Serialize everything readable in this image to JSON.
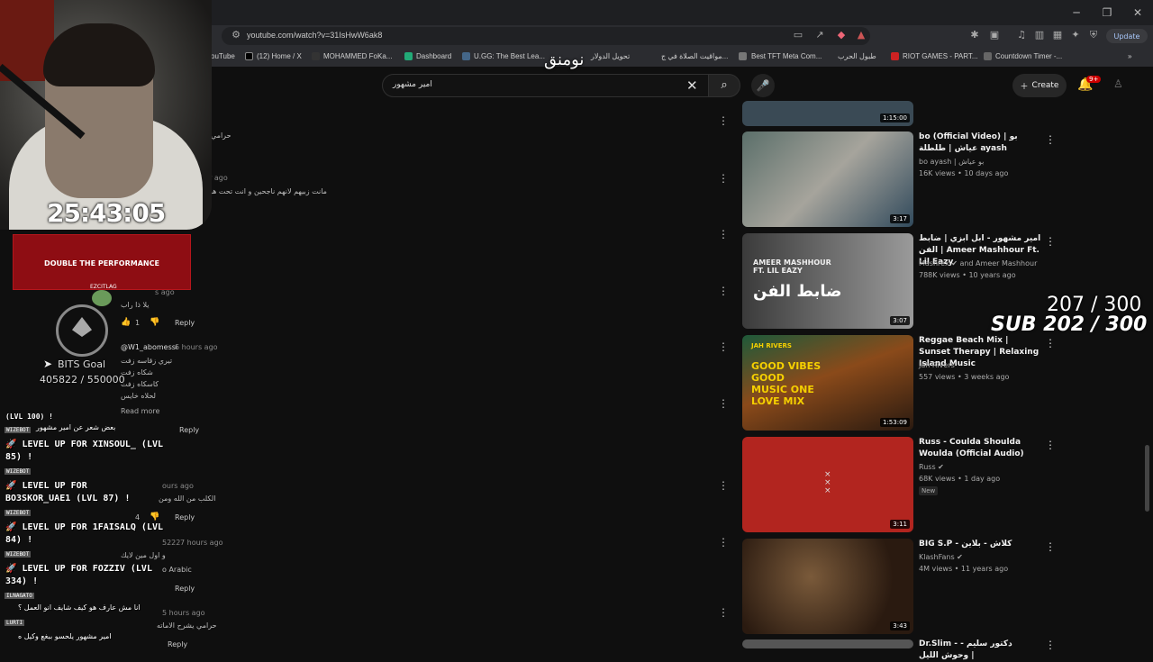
{
  "browser": {
    "url": "youtube.com/watch?v=31IsHwW6ak8",
    "update_label": "Update",
    "bookmarks": [
      {
        "label": "ouTube",
        "color": "#d00"
      },
      {
        "label": "(12) Home / X",
        "color": "#000"
      },
      {
        "label": "MOHAMMED FoKa...",
        "color": "#111"
      },
      {
        "label": "Dashboard",
        "color": "#2a7"
      },
      {
        "label": "U.GG: The Best Lea...",
        "color": "#468"
      },
      {
        "label": "تحويل الدولار",
        "color": "#333"
      },
      {
        "label": "مواقيت الصلاة في ج...",
        "color": "#555"
      },
      {
        "label": "Best TFT Meta Com...",
        "color": "#777"
      },
      {
        "label": "طبول الحرب",
        "color": "#444"
      },
      {
        "label": "RIOT GAMES - PART...",
        "color": "#c22"
      },
      {
        "label": "Countdown Timer -...",
        "color": "#666"
      }
    ]
  },
  "header": {
    "search_value": "امير مشهور",
    "create_label": "Create",
    "notif_count": "9+"
  },
  "overlay": {
    "timer": "25:43:05",
    "arabic_text": "نومنق",
    "promo": "DOUBLE THE PERFORMANCE",
    "promo_brand": "EZCITLAG",
    "bits_label": "BITS Goal",
    "bits_count": "405822 / 550000",
    "sub_line1": "207 / 300",
    "sub_line2": "SUB 202 / 300"
  },
  "comments": {
    "c1_text": "حرامي",
    "c2_time": "r ago",
    "c2_text": "مانت زبيهم لانهم ناجحين و انت تحت هو",
    "c3_time": "s ago",
    "c3_text": "يلا ذا راب",
    "c3_likes": "1",
    "reply": "Reply",
    "c4_user": "@W1_abomessi",
    "c4_time": "6 hours ago",
    "c4_lines": [
      "تيري زقاسه زفت",
      "شكاه زفت",
      "كاسكاه زفت",
      "لحلاه خايس"
    ],
    "read_more": "Read more",
    "c5_text": "بعض شعر عن امير مشهور",
    "c6_time": "ours ago",
    "c6_text": "الكلب من الله ومن",
    "c6_likes": "4",
    "c7_user": "5222",
    "c7_time": "7 hours ago",
    "c7_text": "و اول مين لايك",
    "c7_lang": "o Arabic",
    "c8_time": "5 hours ago",
    "c8_text": "حرامي يشرح الاماته"
  },
  "chat": {
    "nick1": "WIZEBOT",
    "l1": "🚀 LEVEL UP FOR XINSOUL_ (LVL",
    "l1b": "85) !",
    "l2": "🚀 LEVEL UP FOR",
    "l2b": "BO3SKOR_UAE1 (LVL 87) !",
    "l3": "🚀 LEVEL UP FOR 1FAISALQ (LVL",
    "l3b": "84) !",
    "l4": "🚀 LEVEL UP FOR FOZZIV (LVL",
    "l4b": "334) !",
    "nick_ilnagato": "ILNAGATO",
    "ar1": "انا مش عارف هو كيف شايف انو العمل ؟",
    "nick_lurt": "LURTI",
    "ar2": "امير مشهور يلحسو ببغع وكيل ه",
    "lvl_top": "(LVL 100) !"
  },
  "sidebar": {
    "videos": [
      {
        "title": "",
        "channel": "",
        "stats": "",
        "duration": "1:15:00"
      },
      {
        "title": "bo (Official Video) | بو عياش | طلطلة ayash",
        "channel": "bo ayash | بو عياش",
        "stats": "16K views • 10 days ago",
        "duration": "3:17"
      },
      {
        "title": "امير مشهور - ابل ابزي | ضابط الفن | Ameer Mashhour Ft. Lil Eazy",
        "channel": "Mashrex ✔ and Ameer Mashhour",
        "stats": "788K views • 10 years ago",
        "duration": "3:07"
      },
      {
        "title": "Reggae Beach Mix | Sunset Therapy | Relaxing Island Music",
        "channel": "Jah Rivers",
        "stats": "557 views • 3 weeks ago",
        "duration": "1:53:09"
      },
      {
        "title": "Russ - Coulda Shoulda Woulda (Official Audio)",
        "channel": "Russ ✔",
        "stats": "68K views • 1 day ago",
        "duration": "3:11",
        "badge": "New"
      },
      {
        "title": "BIG S.P - كلاش - بلاين",
        "channel": "KlashFans ✔",
        "stats": "4M views • 11 years ago",
        "duration": "3:43"
      },
      {
        "title": "Dr.Slim - دكتور سليم - وحوش الليل |",
        "channel": "",
        "stats": "",
        "duration": ""
      }
    ],
    "thumb_text_ameer": "AMEER MASHHOUR FT. LIL EAZY",
    "thumb_text_ameer_ar": "ضابط الفن",
    "thumb_text_jah1": "JAH RIVERS",
    "thumb_text_jah2": "GOOD VIBES GOOD MUSIC ONE LOVE MIX"
  },
  "colors": {
    "background": "#0f0f0f",
    "promo_red": "#8e0d13",
    "russ_red": "#b2251f",
    "notif_red": "#cc0000"
  }
}
